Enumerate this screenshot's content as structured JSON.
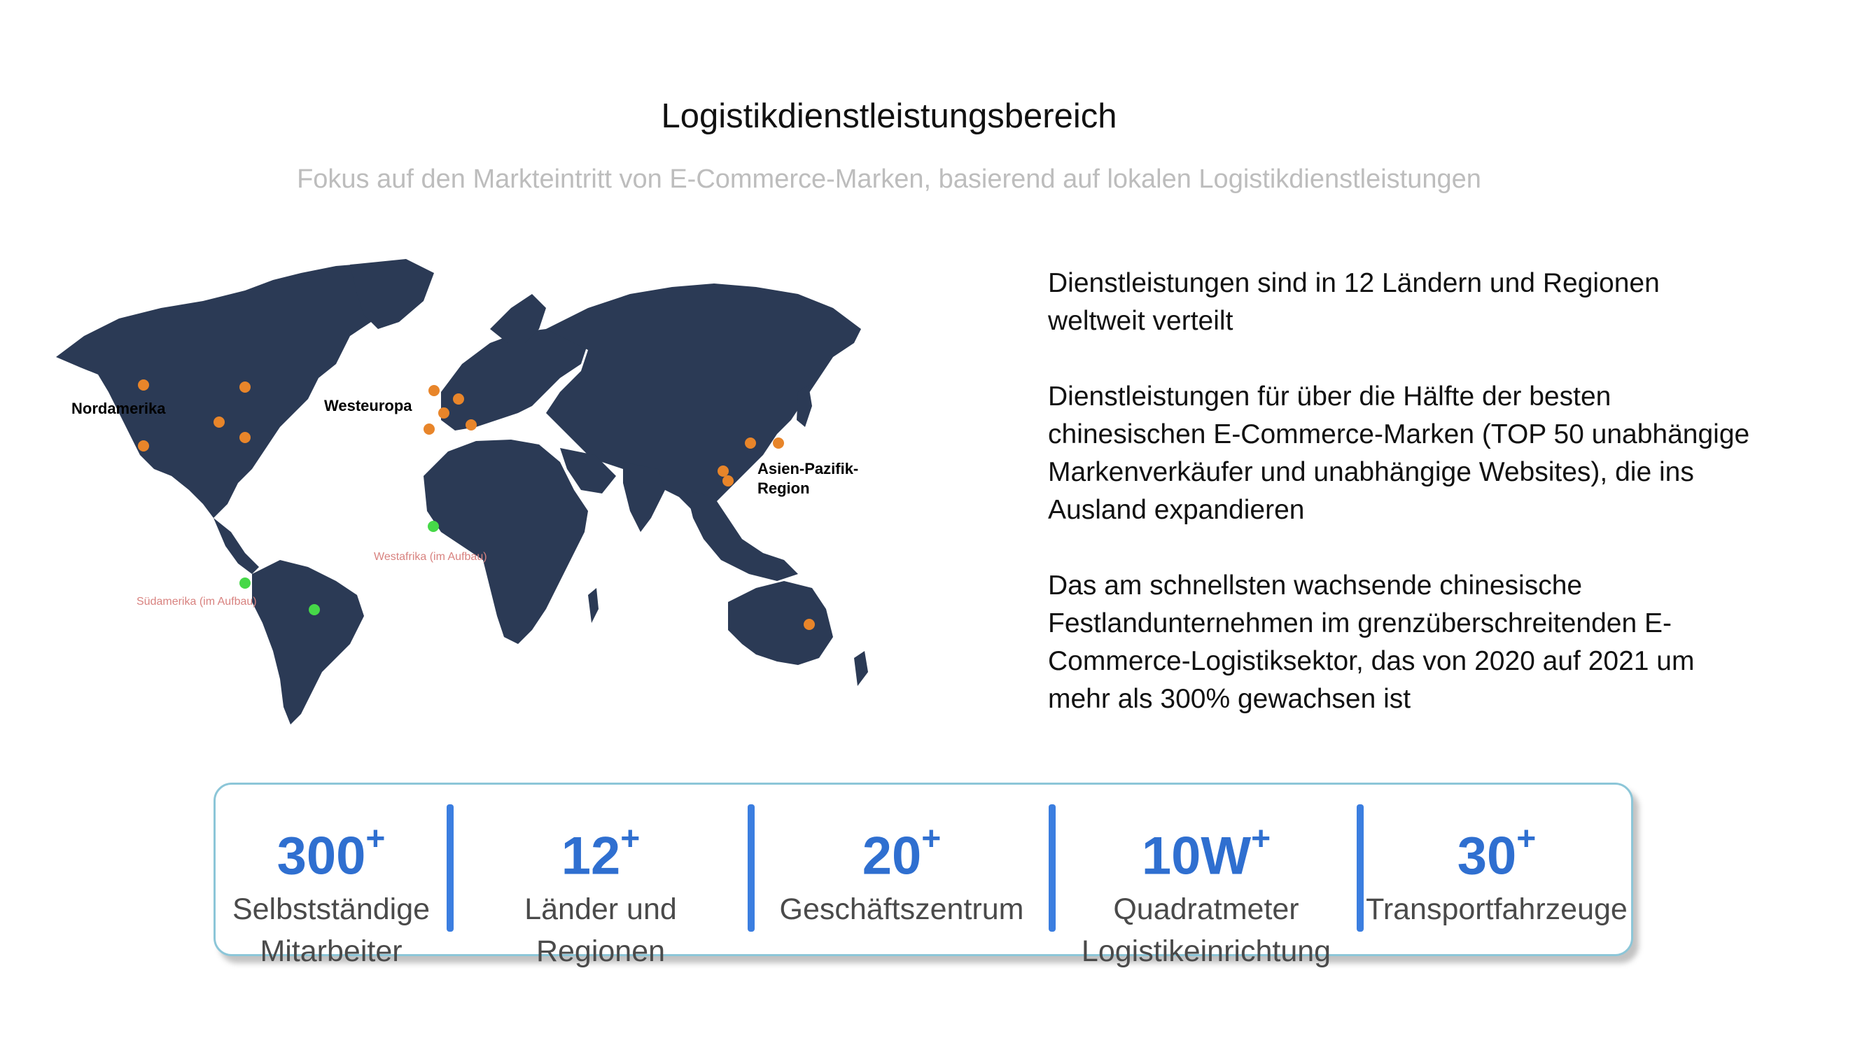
{
  "header": {
    "title": "Logistikdienstleistungsbereich",
    "subtitle": "Fokus auf den Markteintritt von E-Commerce-Marken, basierend auf lokalen Logistikdienstleistungen"
  },
  "map": {
    "land_color": "#2b3a55",
    "active_color": "#e8852a",
    "building_color": "#46d848",
    "labels": {
      "north_america": "Nordamerika",
      "western_europe": "Westeuropa",
      "asia_pacific_1": "Asien-Pazifik-",
      "asia_pacific_2": "Region",
      "west_africa": "Westafrika (im Aufbau)",
      "south_america": "Südamerika (im Aufbau)"
    }
  },
  "description": {
    "p1": "Dienstleistungen sind in 12 Ländern und Regionen weltweit verteilt",
    "p2": "Dienstleistungen für über die Hälfte der besten chinesischen E-Commerce-Marken (TOP 50 unabhängige Markenverkäufer und unabhängige Websites), die ins Ausland expandieren",
    "p3": "Das am schnellsten wachsende chinesische Festlandunternehmen im grenzüberschreitenden E-Commerce-Logistiksektor, das von 2020 auf 2021 um mehr als 300% gewachsen ist"
  },
  "stats": [
    {
      "value": "300",
      "sup": "+",
      "label1": "Selbstständige",
      "label2": "Mitarbeiter"
    },
    {
      "value": "12",
      "sup": "+",
      "label1": "Länder und",
      "label2": "Regionen"
    },
    {
      "value": "20",
      "sup": "+",
      "label1": "Geschäftszentrum",
      "label2": ""
    },
    {
      "value": "10W",
      "sup": "+",
      "label1": "Quadratmeter",
      "label2": "Logistikeinrichtung"
    },
    {
      "value": "30",
      "sup": "+",
      "label1": "Transportfahrzeuge",
      "label2": ""
    }
  ],
  "accent_color": "#2f6fd0"
}
